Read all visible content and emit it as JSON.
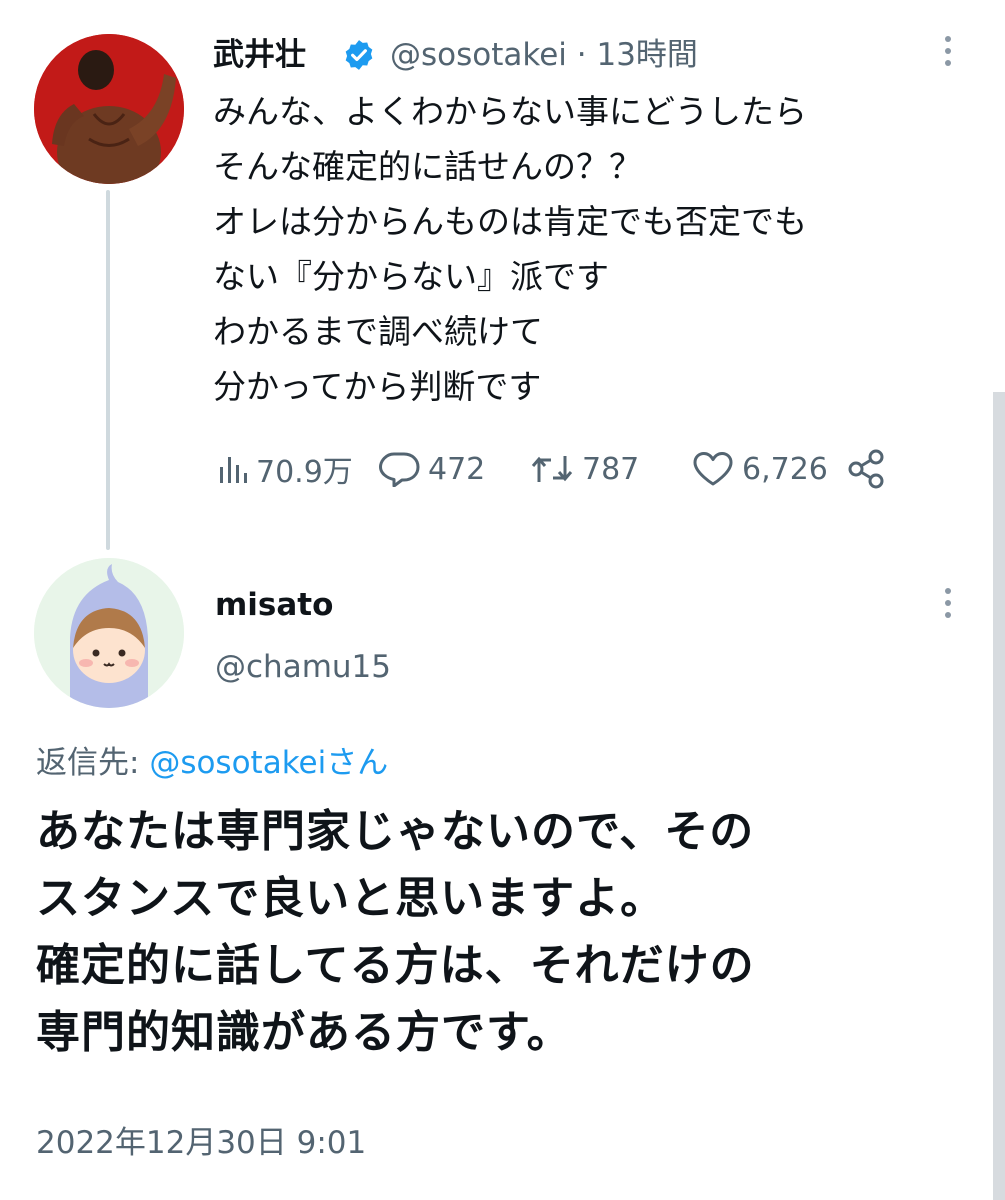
{
  "tweet": {
    "author_name": "武井壮",
    "author_handle": "@sosotakei",
    "time_ago": "· 13時間",
    "lines": [
      "みんな、よくわからない事にどうしたら",
      "そんな確定的に話せんの？？",
      "オレは分からんものは肯定でも否定でも",
      "ない『分からない』派です",
      "わかるまで調べ続けて",
      "分かってから判断です"
    ],
    "stats": {
      "views": "70.9万",
      "replies": "472",
      "retweets": "787",
      "likes": "6,726"
    },
    "icons": [
      "verified-badge-icon",
      "more-icon",
      "views-icon",
      "reply-icon",
      "retweet-icon",
      "like-icon",
      "share-icon"
    ]
  },
  "reply": {
    "author_name": "misato",
    "author_handle": "@chamu15",
    "reply_to_prefix": "返信先: ",
    "reply_to_handle": "@sosotakeiさん",
    "lines": [
      "あなたは専門家じゃないので、その",
      "スタンスで良いと思いますよ。",
      "確定的に話してる方は、それだけの",
      "専門的知識がある方です。"
    ],
    "timestamp": "2022年12月30日 9:01"
  },
  "colors": {
    "text": "#0f1419",
    "secondary": "#536471",
    "accent": "#1d9bf0",
    "thread_line": "#cfd9de"
  }
}
